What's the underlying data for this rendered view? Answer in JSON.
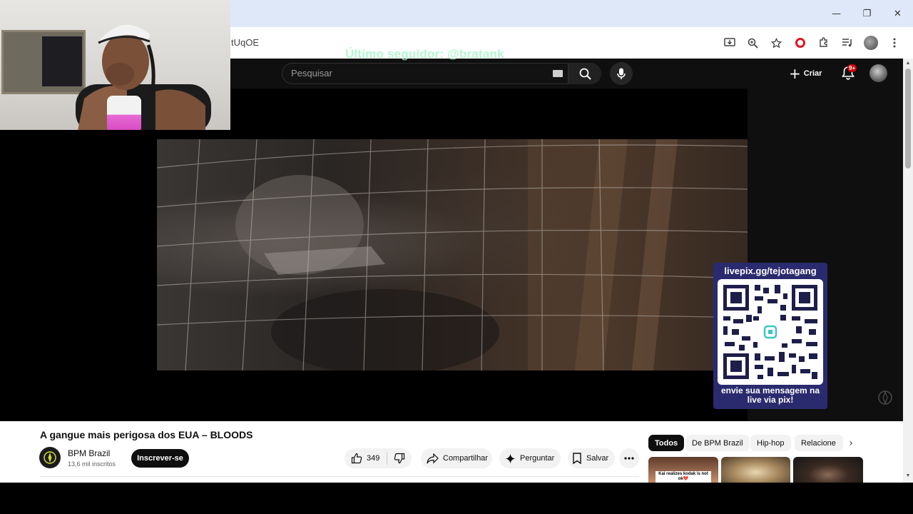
{
  "browser": {
    "url_fragment": "tUqOE",
    "window_controls": {
      "minimize": "—",
      "restore": "❐",
      "close": "✕"
    }
  },
  "overlay": {
    "last_follower": "Último seguidor: @bratank"
  },
  "header": {
    "search_placeholder": "Pesquisar",
    "create_label": "Criar",
    "notification_badge": "9+"
  },
  "donation": {
    "link": "livepix.gg/tejotagang",
    "message": "envie sua mensagem na live via pix!"
  },
  "video": {
    "title": "A gangue mais perigosa dos EUA – BLOODS",
    "channel_name": "BPM Brazil",
    "subscribers": "13,6 mil inscritos",
    "subscribe_label": "Inscrever-se",
    "likes": "349",
    "share_label": "Compartilhar",
    "ask_label": "Perguntar",
    "save_label": "Salvar"
  },
  "chips": [
    "Todos",
    "De BPM Brazil",
    "Hip-hop",
    "Relacione"
  ],
  "thumbnails": [
    {
      "caption": "Kai realizes kodak is not ok💔"
    }
  ],
  "colors": {
    "overlay_text": "#9bf5c4",
    "qr_panel": "#2a2a6e",
    "notification_badge": "#cc0000"
  }
}
